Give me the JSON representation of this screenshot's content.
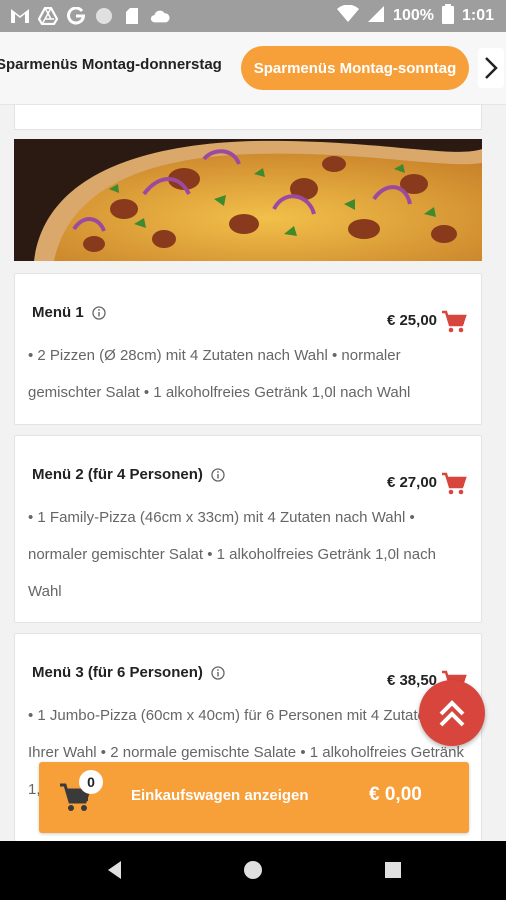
{
  "status_bar": {
    "battery": "100%",
    "time": "1:01",
    "left_icons": [
      "gmail-icon",
      "drive-icon",
      "google-icon",
      "circle-icon",
      "sim-icon",
      "cloud-icon"
    ],
    "right_icons": [
      "wifi-icon",
      "signal-icon",
      "battery-icon"
    ]
  },
  "category_tabs": {
    "items": [
      {
        "label": "Sparmenüs Montag-donnerstag",
        "active": false
      },
      {
        "label": "Sparmenüs Montag-sonntag",
        "active": true
      }
    ],
    "next_icon": "chevron-right-icon"
  },
  "colors": {
    "accent": "#f7a03a",
    "cart_icon": "#d8453c",
    "fab": "#d8453c"
  },
  "menu_items": [
    {
      "title": "Menü 1",
      "price": "€ 25,00",
      "description": "• 2 Pizzen (Ø 28cm) mit 4 Zutaten nach Wahl • normaler gemischter Salat • 1 alkoholfreies Getränk 1,0l nach Wahl"
    },
    {
      "title": "Menü 2 (für 4 Personen)",
      "price": "€ 27,00",
      "description": "• 1 Family-Pizza (46cm x 33cm) mit 4 Zutaten nach Wahl • normaler gemischter Salat • 1 alkoholfreies Getränk 1,0l nach Wahl"
    },
    {
      "title": "Menü 3 (für 6 Personen)",
      "price": "€ 38,50",
      "description": "• 1 Jumbo-Pizza (60cm x 40cm) für 6 Personen mit 4 Zutaten Ihrer Wahl • 2 normale gemischte Salate • 1 alkoholfreies Getränk 1,0l nach Wahl"
    }
  ],
  "cart_bar": {
    "count": "0",
    "label": "Einkaufswagen anzeigen",
    "total": "€ 0,00"
  },
  "nav_bar": {
    "buttons": [
      "back-icon",
      "home-icon",
      "recents-icon"
    ]
  }
}
